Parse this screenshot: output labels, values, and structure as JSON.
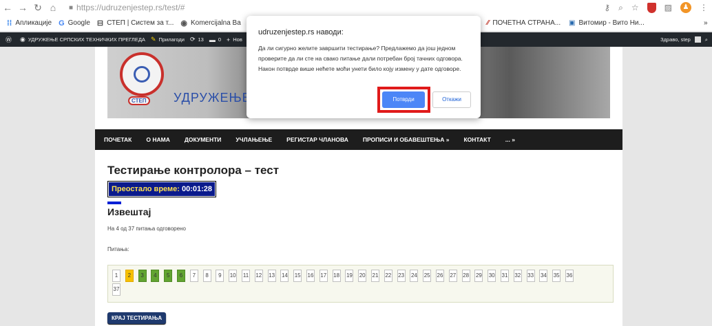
{
  "browser": {
    "url": "https://udruzenjestep.rs/test/#",
    "bookmarks": [
      {
        "label": "Апликације",
        "icon": "apps-grid-icon"
      },
      {
        "label": "Google",
        "icon": "google-icon"
      },
      {
        "label": "СТЕП | Систем за т...",
        "icon": "page-icon"
      },
      {
        "label": "Komercijalna Ba",
        "icon": "globe-icon"
      }
    ],
    "bookmarks_right": [
      {
        "label": "ПОЧЕТНА СТРАНА...",
        "icon": "bookmark-icon"
      },
      {
        "label": "Витомир - Вито Ни...",
        "icon": "image-icon"
      }
    ],
    "more": "»"
  },
  "adminbar": {
    "site_name": "УДРУЖЕЊЕ СРПСКИХ ТЕХНИЧКИХ ПРЕГЛЕДА",
    "customize": "Прилагоди",
    "updates": "13",
    "comments": "0",
    "new": "Нов",
    "greeting": "Здраво, step"
  },
  "header": {
    "title": "УДРУЖЕЊЕ",
    "logo_text": "СТЕП"
  },
  "menu": [
    "ПОЧЕТАК",
    "О НАМА",
    "ДОКУМЕНТИ",
    "УЧЛАЊЕЊЕ",
    "РЕГИСТАР ЧЛАНОВА",
    "ПРОПИСИ И ОБАВЕШТЕЊА »",
    "КОНТАКТ",
    "... »"
  ],
  "content": {
    "title": "Тестирање контролора – тест",
    "timer_label": "Преостало време:",
    "timer_value": "00:01:28",
    "report_title": "Извештај",
    "answered": "На 4 од 37 питања одговорено",
    "questions_label": "Питања:",
    "finish_button": "КРАЈ ТЕСТИРАЊА"
  },
  "questions": {
    "total": 37,
    "current": 2,
    "answered": [
      3,
      4,
      5,
      6
    ]
  },
  "dialog": {
    "title": "udruzenjestep.rs наводи:",
    "message": "Да ли сигурно желите завршити тестирање? Предлажемо да још једном проверите да ли сте на свако питање дали потребан број тачних одговора. Након потврде више нећете моћи унети било коју измену у дате одговоре.",
    "confirm": "Потврди",
    "cancel": "Откажи"
  },
  "colors": {
    "accent": "#4c86f7",
    "highlight": "#e01a1a",
    "answered": "#62a431",
    "current": "#f6c100",
    "timer_bg": "#0a1a8c"
  }
}
